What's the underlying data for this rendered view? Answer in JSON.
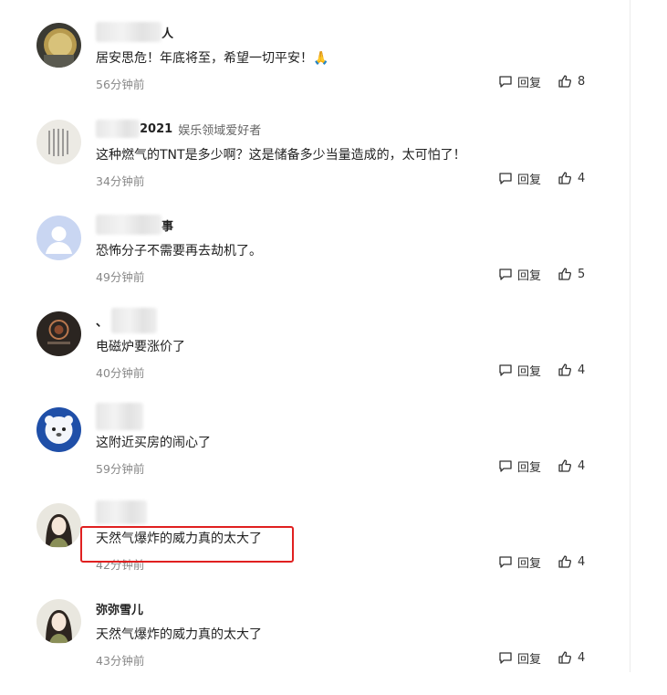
{
  "actions": {
    "reply_label": "回复"
  },
  "comments": [
    {
      "name_suffix": "人",
      "badge": "",
      "content": "居安思危！年底将至，希望一切平安！🙏",
      "time": "56分钟前",
      "likes": "8"
    },
    {
      "name_suffix": "2021",
      "badge": "娱乐领域爱好者",
      "content": "这种燃气的TNT是多少啊？这是储备多少当量造成的，太可怕了！",
      "time": "34分钟前",
      "likes": "4"
    },
    {
      "name_suffix": "事",
      "badge": "",
      "content": "恐怖分子不需要再去劫机了。",
      "time": "49分钟前",
      "likes": "5"
    },
    {
      "name_suffix": "、",
      "badge": "",
      "content": "电磁炉要涨价了",
      "time": "40分钟前",
      "likes": "4"
    },
    {
      "name_suffix": "",
      "badge": "",
      "content": "这附近买房的闹心了",
      "time": "59分钟前",
      "likes": "4"
    },
    {
      "name_suffix": "",
      "badge": "",
      "content": "天然气爆炸的威力真的太大了",
      "time": "42分钟前",
      "likes": "4"
    },
    {
      "name": "弥弥雪儿",
      "badge": "",
      "content": "天然气爆炸的威力真的太大了",
      "time": "43分钟前",
      "likes": "4"
    }
  ]
}
